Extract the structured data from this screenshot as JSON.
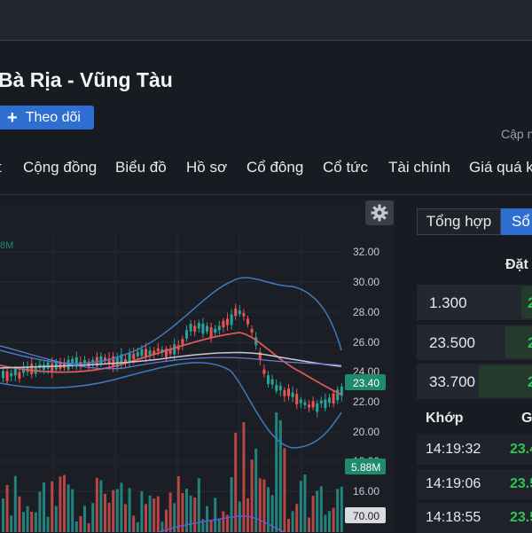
{
  "header": {
    "title": "Bà Rịa - Vũng Tàu",
    "follow_label": "Theo dõi",
    "update_label": "Cập n"
  },
  "nav": {
    "items": [
      "t",
      "Cộng đồng",
      "Biểu đồ",
      "Hồ sơ",
      "Cổ đông",
      "Cổ tức",
      "Tài chính",
      "Giá quá k"
    ]
  },
  "chart": {
    "settings_icon": "gear-icon",
    "top_vol_label": "8M",
    "y_ticks": [
      "32.00",
      "30.00",
      "28.00",
      "26.00",
      "24.00",
      "22.00",
      "20.00",
      "18.00",
      "16.00"
    ],
    "price_badge": "23.40",
    "volume_badge": "5.88M",
    "indicator_badge": "70.00",
    "colors": {
      "up": "#26a69a",
      "down": "#ef5350",
      "ma_red": "#e0585a",
      "ma_white": "#c8cbd2",
      "band": "#3d7bbf",
      "badge_price": "#1e8a6e",
      "indicator": "#6a56d8"
    }
  },
  "panel": {
    "tabs": [
      "Tổng hợp",
      "Sổ"
    ],
    "order_header": "Đặt",
    "orders": [
      {
        "price": "1.300",
        "vol": "2"
      },
      {
        "price": "23.500",
        "vol": "2"
      },
      {
        "price": "33.700",
        "vol": "2"
      }
    ],
    "match_header": "Khớp",
    "match_header_2": "G",
    "trades": [
      {
        "time": "14:19:32",
        "price": "23.4"
      },
      {
        "time": "14:19:06",
        "price": "23.5"
      },
      {
        "time": "14:18:55",
        "price": "23.5"
      }
    ]
  }
}
